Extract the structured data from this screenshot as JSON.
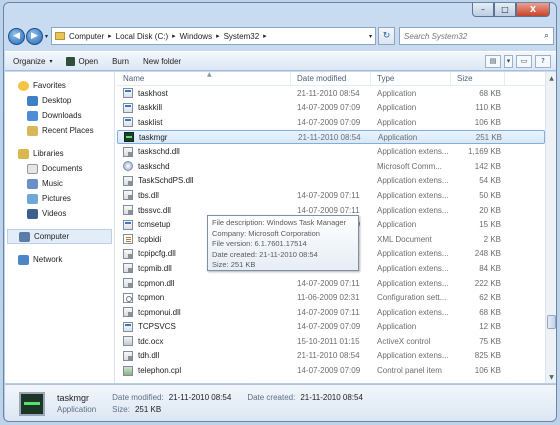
{
  "window": {
    "minimize": "–",
    "maximize": "□",
    "close": "X"
  },
  "nav": {
    "back": "◀",
    "forward": "▶",
    "history": "▾"
  },
  "address": {
    "crumbs": [
      "Computer",
      "Local Disk (C:)",
      "Windows",
      "System32"
    ],
    "separator": "▸",
    "dropdown": "▾",
    "refresh": "↻"
  },
  "search": {
    "placeholder": "Search System32",
    "icon": "⌕"
  },
  "toolbar": {
    "organize": "Organize",
    "organize_caret": "▾",
    "open": "Open",
    "burn": "Burn",
    "new_folder": "New folder",
    "view_icon": "▤",
    "view_caret": "▾",
    "preview_icon": "▭",
    "help_icon": "?"
  },
  "navpane": {
    "favorites": "Favorites",
    "desktop": "Desktop",
    "downloads": "Downloads",
    "recent": "Recent Places",
    "libraries": "Libraries",
    "documents": "Documents",
    "music": "Music",
    "pictures": "Pictures",
    "videos": "Videos",
    "computer": "Computer",
    "network": "Network"
  },
  "columns": {
    "name": "Name",
    "date": "Date modified",
    "type": "Type",
    "size": "Size",
    "sort_arrow": "▲"
  },
  "files": [
    {
      "name": "taskhost",
      "date": "21-11-2010 08:54",
      "type": "Application",
      "size": "68 KB",
      "icon": "app"
    },
    {
      "name": "taskkill",
      "date": "14-07-2009 07:09",
      "type": "Application",
      "size": "110 KB",
      "icon": "app"
    },
    {
      "name": "tasklist",
      "date": "14-07-2009 07:09",
      "type": "Application",
      "size": "106 KB",
      "icon": "app"
    },
    {
      "name": "taskmgr",
      "date": "21-11-2010 08:54",
      "type": "Application",
      "size": "251 KB",
      "icon": "tm"
    },
    {
      "name": "taskschd.dll",
      "date": "",
      "type": "Application extens...",
      "size": "1,169 KB",
      "icon": "dll"
    },
    {
      "name": "taskschd",
      "date": "",
      "type": "Microsoft Comm...",
      "size": "142 KB",
      "icon": "msc"
    },
    {
      "name": "TaskSchdPS.dll",
      "date": "",
      "type": "Application extens...",
      "size": "54 KB",
      "icon": "dll"
    },
    {
      "name": "tbs.dll",
      "date": "14-07-2009 07:11",
      "type": "Application extens...",
      "size": "50 KB",
      "icon": "dll"
    },
    {
      "name": "tbssvc.dll",
      "date": "14-07-2009 07:11",
      "type": "Application extens...",
      "size": "20 KB",
      "icon": "dll"
    },
    {
      "name": "tcmsetup",
      "date": "14-07-2009 07:09",
      "type": "Application",
      "size": "15 KB",
      "icon": "app"
    },
    {
      "name": "tcpbidi",
      "date": "11-06-2009 02:31",
      "type": "XML Document",
      "size": "2 KB",
      "icon": "xml"
    },
    {
      "name": "tcpipcfg.dll",
      "date": "21-11-2010 08:54",
      "type": "Application extens...",
      "size": "248 KB",
      "icon": "dll"
    },
    {
      "name": "tcpmib.dll",
      "date": "14-07-2009 07:11",
      "type": "Application extens...",
      "size": "84 KB",
      "icon": "dll"
    },
    {
      "name": "tcpmon.dll",
      "date": "14-07-2009 07:11",
      "type": "Application extens...",
      "size": "222 KB",
      "icon": "dll"
    },
    {
      "name": "tcpmon",
      "date": "11-06-2009 02:31",
      "type": "Configuration sett...",
      "size": "62 KB",
      "icon": "cfg"
    },
    {
      "name": "tcpmonui.dll",
      "date": "14-07-2009 07:11",
      "type": "Application extens...",
      "size": "68 KB",
      "icon": "dll"
    },
    {
      "name": "TCPSVCS",
      "date": "14-07-2009 07:09",
      "type": "Application",
      "size": "12 KB",
      "icon": "app"
    },
    {
      "name": "tdc.ocx",
      "date": "15-10-2011 01:15",
      "type": "ActiveX control",
      "size": "75 KB",
      "icon": "ocx"
    },
    {
      "name": "tdh.dll",
      "date": "21-11-2010 08:54",
      "type": "Application extens...",
      "size": "825 KB",
      "icon": "dll"
    },
    {
      "name": "telephon.cpl",
      "date": "14-07-2009 07:09",
      "type": "Control panel item",
      "size": "106 KB",
      "icon": "cpl"
    }
  ],
  "tooltip": {
    "description": "File description: Windows Task Manager",
    "company": "Company: Microsoft Corporation",
    "version": "File version: 6.1.7601.17514",
    "created": "Date created: 21-11-2010 08:54",
    "size": "Size: 251 KB"
  },
  "scrollbar": {
    "up": "▲",
    "down": "▼"
  },
  "details": {
    "name": "taskmgr",
    "type": "Application",
    "modified_label": "Date modified:",
    "modified_value": "21-11-2010 08:54",
    "created_label": "Date created:",
    "created_value": "21-11-2010 08:54",
    "size_label": "Size:",
    "size_value": "251 KB"
  },
  "colors": {
    "accent": "#2a67ad",
    "selection": "#d6e8fa",
    "window": "#bcd3ea"
  }
}
